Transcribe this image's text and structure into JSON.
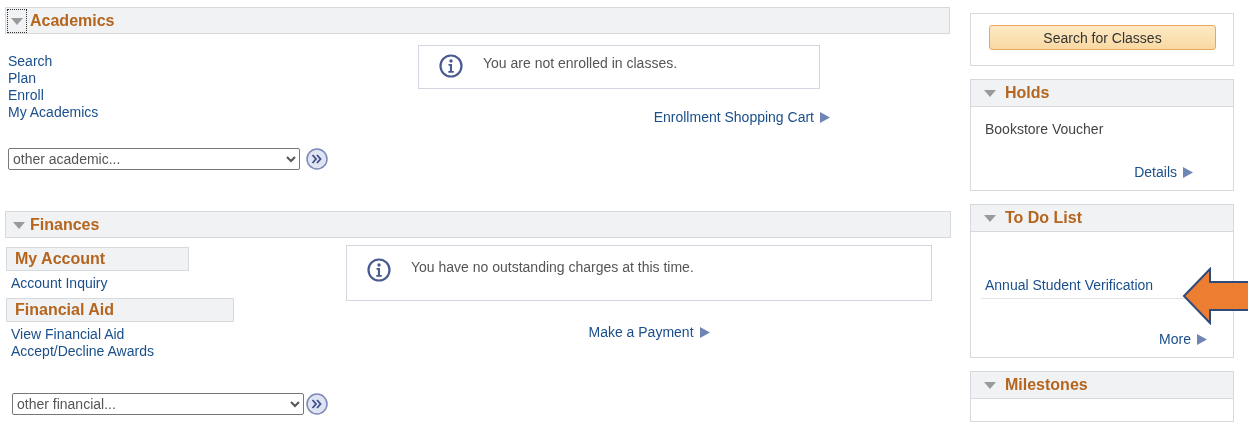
{
  "academics": {
    "title": "Academics",
    "expanded": true,
    "links": [
      "Search",
      "Plan",
      "Enroll",
      "My Academics"
    ],
    "select": {
      "value": "other academic..."
    },
    "message": "You are not enrolled in classes.",
    "link": "Enrollment Shopping Cart"
  },
  "finances": {
    "title": "Finances",
    "expanded": true,
    "groups": [
      {
        "title": "My Account",
        "links": [
          "Account Inquiry"
        ]
      },
      {
        "title": "Financial Aid",
        "links": [
          "View Financial Aid",
          "Accept/Decline Awards"
        ]
      }
    ],
    "select": {
      "value": "other financial..."
    },
    "message": "You have no outstanding charges at this time.",
    "link": "Make a Payment"
  },
  "search_button": "Search for Classes",
  "holds": {
    "title": "Holds",
    "expanded": true,
    "items": [
      "Bookstore Voucher"
    ],
    "link": "Details"
  },
  "todo": {
    "title": "To Do List",
    "expanded": true,
    "items": [
      "Annual Student Verification"
    ],
    "link": "More"
  },
  "milestones": {
    "title": "Milestones",
    "expanded": true
  }
}
